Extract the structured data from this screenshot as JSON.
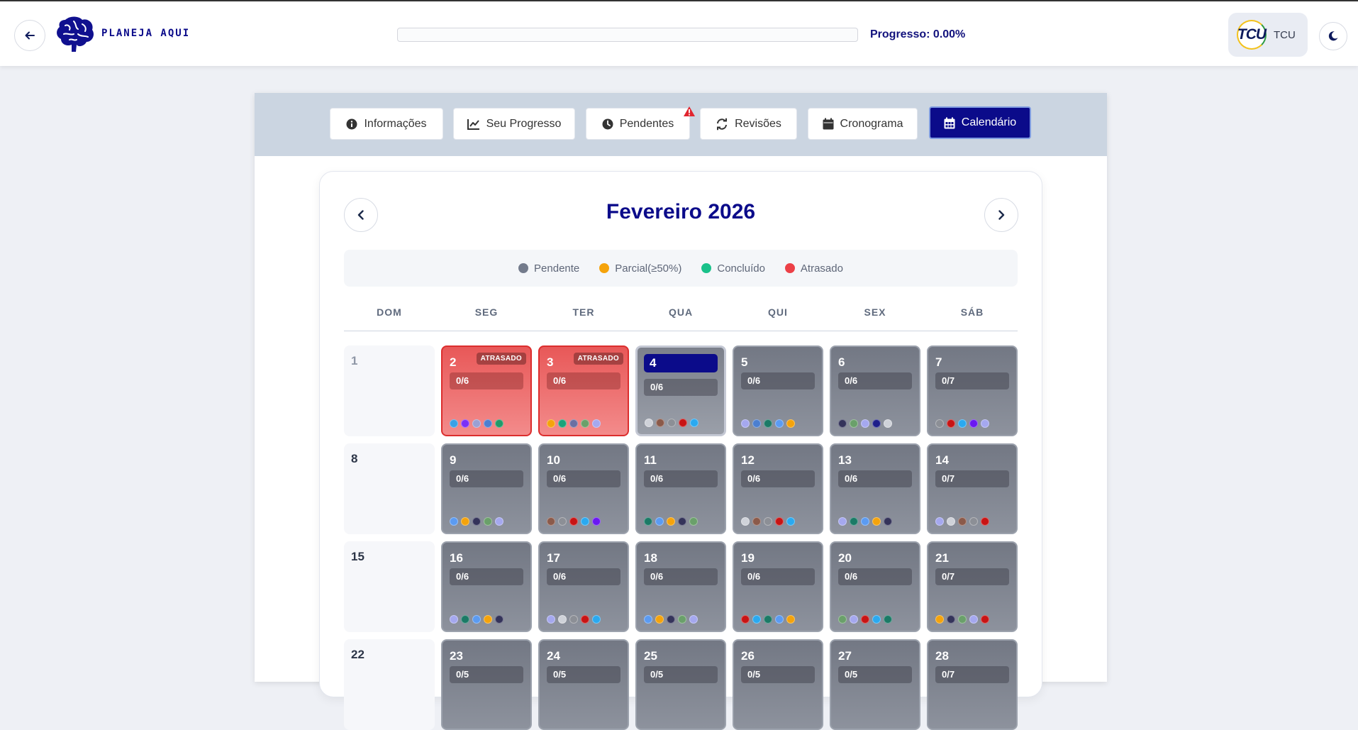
{
  "header": {
    "brand": "PLANEJA AQUI",
    "progress_text": "Progresso: 0.00%",
    "progress_value": 0,
    "user_logo_text": "TCU",
    "user_name": "TCU"
  },
  "tabs": [
    {
      "label": "Informações",
      "icon": "info-circle-icon",
      "active": false
    },
    {
      "label": "Seu Progresso",
      "icon": "chart-line-icon",
      "active": false
    },
    {
      "label": "Pendentes",
      "icon": "clock-icon",
      "active": false,
      "alert": true
    },
    {
      "label": "Revisões",
      "icon": "refresh-icon",
      "active": false
    },
    {
      "label": "Cronograma",
      "icon": "calendar-icon",
      "active": false
    },
    {
      "label": "Calendário",
      "icon": "calendar-grid-icon",
      "active": true
    }
  ],
  "calendar": {
    "title": "Fevereiro 2026",
    "legend": [
      {
        "label": "Pendente",
        "color": "#737b8c"
      },
      {
        "label": "Parcial(≥50%)",
        "color": "#f5a30b"
      },
      {
        "label": "Concluído",
        "color": "#19c18a"
      },
      {
        "label": "Atrasado",
        "color": "#ec4047"
      }
    ],
    "weekdays": [
      "DOM",
      "SEG",
      "TER",
      "QUA",
      "QUI",
      "SEX",
      "SÁB"
    ],
    "weeks": [
      [
        {
          "day": "1",
          "type": "sunday",
          "light": true
        },
        {
          "day": "2",
          "type": "late",
          "badge": "ATRASADO",
          "count": "0/6",
          "dots": [
            "#3aa1e6",
            "#7b2ff7",
            "#9aa0d4",
            "#4c7fd0",
            "#1f9a6a"
          ]
        },
        {
          "day": "3",
          "type": "late",
          "badge": "ATRASADO",
          "count": "0/6",
          "dots": [
            "#f5a30b",
            "#1aa37a",
            "#6b6fa2",
            "#6aa06a",
            "#a5a8ef"
          ]
        },
        {
          "day": "4",
          "type": "today",
          "count": "0/6",
          "dots": [
            "#cfd2d9",
            "#8b5a4a",
            "#8c8f96",
            "#c81414",
            "#2aa9f0"
          ]
        },
        {
          "day": "5",
          "type": "pending",
          "count": "0/6",
          "dots": [
            "#a5a8ef",
            "#4c7fd0",
            "#1b7a66",
            "#5b9bf2",
            "#f5a30b"
          ]
        },
        {
          "day": "6",
          "type": "pending",
          "count": "0/6",
          "dots": [
            "#34335a",
            "#6aa06a",
            "#a5a8ef",
            "#1f1f8a",
            "#cfd2d9"
          ]
        },
        {
          "day": "7",
          "type": "pending",
          "count": "0/7",
          "dots": [
            "#8c8f96",
            "#c81414",
            "#2aa9f0",
            "#6a18f2",
            "#a5a8ef"
          ]
        }
      ],
      [
        {
          "day": "8",
          "type": "sunday"
        },
        {
          "day": "9",
          "type": "pending",
          "count": "0/6",
          "dots": [
            "#5b9bf2",
            "#f5a30b",
            "#34335a",
            "#6aa06a",
            "#a5a8ef"
          ]
        },
        {
          "day": "10",
          "type": "pending",
          "count": "0/6",
          "dots": [
            "#8b5a4a",
            "#8c8f96",
            "#c81414",
            "#2aa9f0",
            "#6a18f2"
          ]
        },
        {
          "day": "11",
          "type": "pending",
          "count": "0/6",
          "dots": [
            "#1b7a66",
            "#5b9bf2",
            "#f5a30b",
            "#34335a",
            "#6aa06a"
          ]
        },
        {
          "day": "12",
          "type": "pending",
          "count": "0/6",
          "dots": [
            "#cfd2d9",
            "#8b5a4a",
            "#8c8f96",
            "#c81414",
            "#2aa9f0"
          ]
        },
        {
          "day": "13",
          "type": "pending",
          "count": "0/6",
          "dots": [
            "#a5a8ef",
            "#1b7a66",
            "#5b9bf2",
            "#f5a30b",
            "#34335a"
          ]
        },
        {
          "day": "14",
          "type": "pending",
          "count": "0/7",
          "dots": [
            "#a5a8ef",
            "#cfd2d9",
            "#8b5a4a",
            "#8c8f96",
            "#c81414"
          ]
        }
      ],
      [
        {
          "day": "15",
          "type": "sunday"
        },
        {
          "day": "16",
          "type": "pending",
          "count": "0/6",
          "dots": [
            "#a5a8ef",
            "#1b7a66",
            "#5b9bf2",
            "#f5a30b",
            "#34335a"
          ]
        },
        {
          "day": "17",
          "type": "pending",
          "count": "0/6",
          "dots": [
            "#a5a8ef",
            "#cfd2d9",
            "#8c8f96",
            "#c81414",
            "#2aa9f0"
          ]
        },
        {
          "day": "18",
          "type": "pending",
          "count": "0/6",
          "dots": [
            "#5b9bf2",
            "#f5a30b",
            "#34335a",
            "#6aa06a",
            "#a5a8ef"
          ]
        },
        {
          "day": "19",
          "type": "pending",
          "count": "0/6",
          "dots": [
            "#c81414",
            "#2aa9f0",
            "#1b7a66",
            "#5b9bf2",
            "#f5a30b"
          ]
        },
        {
          "day": "20",
          "type": "pending",
          "count": "0/6",
          "dots": [
            "#6aa06a",
            "#a5a8ef",
            "#c81414",
            "#2aa9f0",
            "#1b7a66"
          ]
        },
        {
          "day": "21",
          "type": "pending",
          "count": "0/7",
          "dots": [
            "#f5a30b",
            "#34335a",
            "#6aa06a",
            "#a5a8ef",
            "#c81414"
          ]
        }
      ],
      [
        {
          "day": "22",
          "type": "sunday"
        },
        {
          "day": "23",
          "type": "pending",
          "count": "0/5",
          "dots": []
        },
        {
          "day": "24",
          "type": "pending",
          "count": "0/5",
          "dots": []
        },
        {
          "day": "25",
          "type": "pending",
          "count": "0/5",
          "dots": []
        },
        {
          "day": "26",
          "type": "pending",
          "count": "0/5",
          "dots": []
        },
        {
          "day": "27",
          "type": "pending",
          "count": "0/5",
          "dots": []
        },
        {
          "day": "28",
          "type": "pending",
          "count": "0/7",
          "dots": []
        }
      ]
    ]
  }
}
